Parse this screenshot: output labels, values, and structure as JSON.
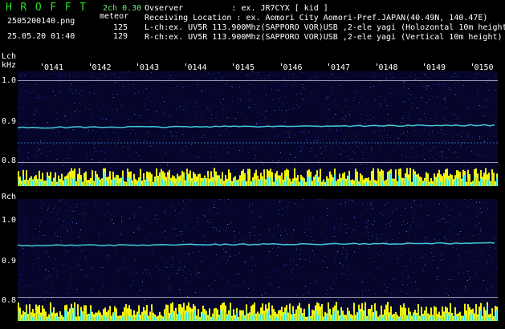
{
  "header": {
    "logo": "HROFFT",
    "mode": "2ch 0.30",
    "filename": "2505200140.png",
    "datetime": "25.05.20 01:40",
    "counter_label": "meteor",
    "counts": [
      "125",
      "129"
    ],
    "observer": "Ovserver          : ex. JR7CYX [ kid ]",
    "location": "Receiving Location : ex. Aomori City Aomori-Pref.JAPAN(40.49N, 140.47E)",
    "lch_info": "L-ch:ex. UV5R 113.900Mhz(SAPPORO VOR)USB ,2-ele yagi (Holozontal 10m height",
    "rch_info": "R-ch:ex. UV5R 113.900Mhz(SAPPORO VOR)USB ,2-ele yagi (Vertical 10m height)"
  },
  "time_ticks": [
    "0141",
    "0142",
    "0143",
    "0144",
    "0145",
    "0146",
    "0147",
    "0148",
    "0149",
    "0150"
  ],
  "lch": {
    "label": "Lch",
    "unit": "kHz",
    "freq_ticks": [
      "1.0",
      "0.9",
      "0.8"
    ]
  },
  "rch": {
    "label": "Rch",
    "freq_ticks": [
      "1.0",
      "0.9",
      "0.8"
    ]
  },
  "colors": {
    "logo": "#2adf2a",
    "trace": "#40c8d8",
    "bar_yellow": "#f4f40a",
    "bar_cyan": "#30e0e0",
    "panel": "#06062c"
  }
}
